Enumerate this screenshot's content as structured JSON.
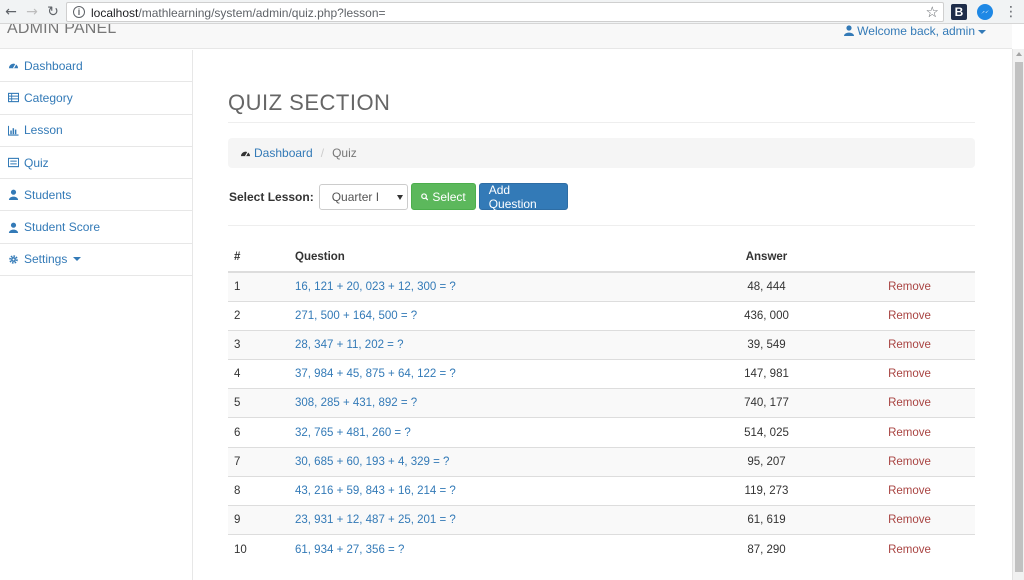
{
  "browser": {
    "url_host": "localhost",
    "url_path": "/mathlearning/system/admin/quiz.php?lesson=",
    "ext_b": "B",
    "nav_back": "←",
    "nav_forward": "→",
    "nav_reload": "↻",
    "star": "☆",
    "menu": "⋮",
    "info": "i"
  },
  "topbar": {
    "brand": "ADMIN PANEL",
    "welcome": "Welcome back, admin"
  },
  "sidebar": {
    "items": [
      {
        "label": "Dashboard",
        "icon": "dashboard-icon"
      },
      {
        "label": "Category",
        "icon": "table-icon"
      },
      {
        "label": "Lesson",
        "icon": "bar-chart-icon"
      },
      {
        "label": "Quiz",
        "icon": "list-icon"
      },
      {
        "label": "Students",
        "icon": "user-icon"
      },
      {
        "label": "Student Score",
        "icon": "user-icon"
      },
      {
        "label": "Settings",
        "icon": "gear-icon"
      }
    ]
  },
  "main": {
    "title": "QUIZ SECTION",
    "breadcrumb": {
      "link": "Dashboard",
      "active": "Quiz"
    },
    "filter": {
      "label": "Select Lesson:",
      "selected_lesson": "Quarter I",
      "select_button": "Select",
      "add_button": "Add Question"
    },
    "table": {
      "headers": {
        "num": "#",
        "question": "Question",
        "answer": "Answer"
      },
      "remove_label": "Remove",
      "rows": [
        {
          "num": "1",
          "question": "16, 121 + 20, 023 + 12, 300 = ?",
          "answer": "48, 444"
        },
        {
          "num": "2",
          "question": "271, 500 + 164, 500 = ?",
          "answer": "436, 000"
        },
        {
          "num": "3",
          "question": "28, 347 + 11, 202 = ?",
          "answer": "39, 549"
        },
        {
          "num": "4",
          "question": "37, 984 + 45, 875 + 64, 122 = ?",
          "answer": "147, 981"
        },
        {
          "num": "5",
          "question": "308, 285 + 431, 892 = ?",
          "answer": "740, 177"
        },
        {
          "num": "6",
          "question": "32, 765 + 481, 260 = ?",
          "answer": "514, 025"
        },
        {
          "num": "7",
          "question": "30, 685 + 60, 193 + 4, 329 = ?",
          "answer": "95, 207"
        },
        {
          "num": "8",
          "question": "43, 216 + 59, 843 + 16, 214 = ?",
          "answer": "119, 273"
        },
        {
          "num": "9",
          "question": "23, 931 + 12, 487 + 25, 201 = ?",
          "answer": "61, 619"
        },
        {
          "num": "10",
          "question": "61, 934 + 27, 356 = ?",
          "answer": "87, 290"
        }
      ]
    }
  },
  "colors": {
    "link": "#337ab7",
    "success": "#5cb85c",
    "primary": "#337ab7",
    "danger_text": "#a94442"
  }
}
